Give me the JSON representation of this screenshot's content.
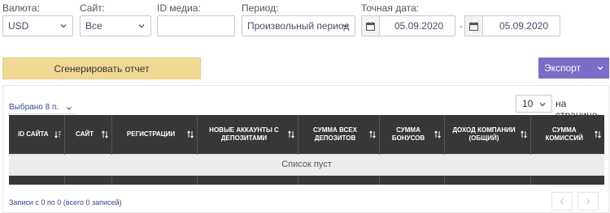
{
  "filters": {
    "currency": {
      "label": "Валюта:",
      "value": "USD"
    },
    "site": {
      "label": "Сайт:",
      "value": "Все"
    },
    "media_id": {
      "label": "ID медиа:",
      "value": ""
    },
    "period": {
      "label": "Период:",
      "value": "Произвольный период"
    },
    "exact_date": {
      "label": "Точная дата:",
      "from": "05.09.2020",
      "separator": "-",
      "to": "05.09.2020"
    }
  },
  "actions": {
    "generate_label": "Сгенерировать отчет",
    "export_label": "Экспорт"
  },
  "table": {
    "selected_label": "Выбрано 8 п.",
    "per_page_value": "10",
    "per_page_label": "на странице",
    "columns": [
      "ID сайта",
      "Сайт",
      "Регистрации",
      "Новые аккаунты с депозитами",
      "Сумма всех депозитов",
      "Сумма бонусов",
      "Доход компании (общий)",
      "Сумма комиссий"
    ],
    "empty_text": "Список пуст",
    "info_text": "Записи с 0 по 0 (всего 0 записей)"
  },
  "colors": {
    "header_bg": "#373737",
    "generate_bg": "#f2d993",
    "export_bg": "#7b6cc6"
  },
  "icons": {
    "dropdown": "chevron-down-icon",
    "calendar": "calendar-icon",
    "sort": "sort-icon",
    "prev": "chevron-left-icon",
    "next": "chevron-right-icon"
  }
}
